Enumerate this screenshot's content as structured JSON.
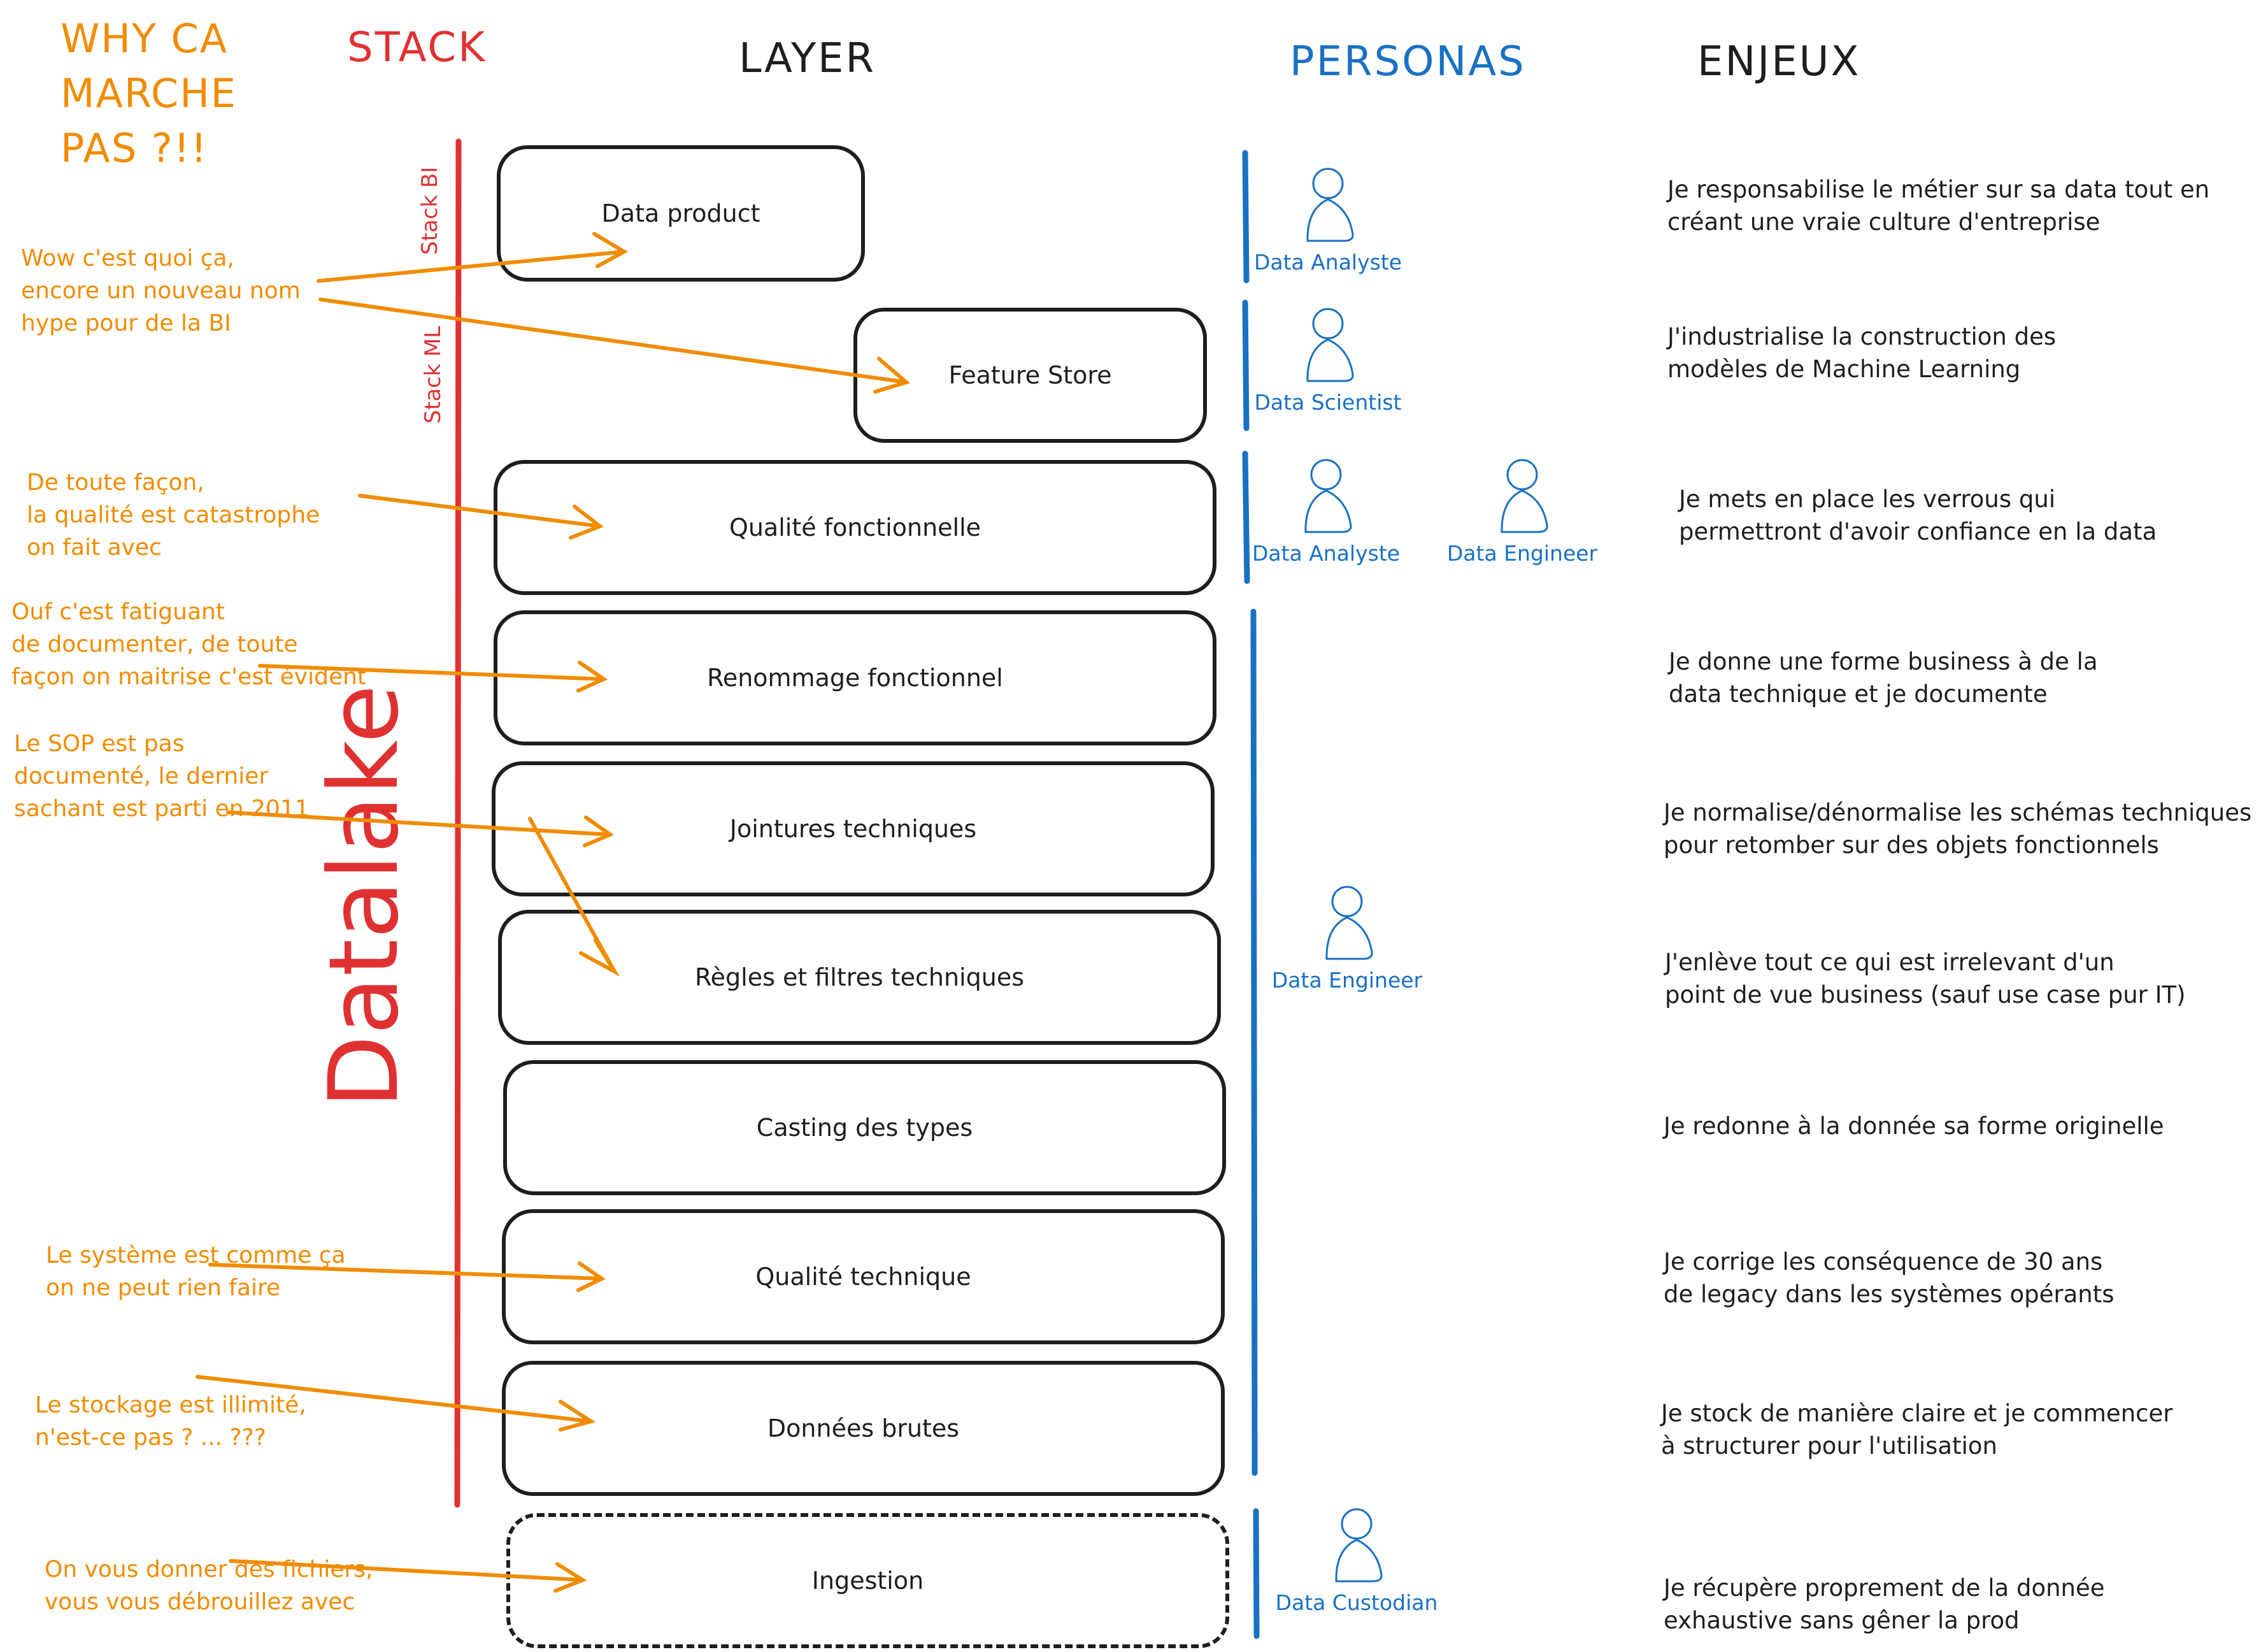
{
  "title": {
    "lines": [
      "WHY CA",
      "MARCHE",
      "PAS ?!!"
    ]
  },
  "headers": {
    "stack": "STACK",
    "layer": "LAYER",
    "personas": "PERSONAS",
    "enjeux": "ENJEUX"
  },
  "stack_labels": {
    "bi": "Stack BI",
    "ml": "Stack ML",
    "datalake": "Datalake"
  },
  "colors": {
    "orange": "#f08c00",
    "red": "#e03131",
    "blue": "#1971c2",
    "ink": "#1e1e1e"
  },
  "layers": [
    {
      "label": "Data product",
      "style": "solid"
    },
    {
      "label": "Feature Store",
      "style": "solid"
    },
    {
      "label": "Qualité fonctionnelle",
      "style": "solid"
    },
    {
      "label": "Renommage fonctionnel",
      "style": "solid"
    },
    {
      "label": "Jointures techniques",
      "style": "solid"
    },
    {
      "label": "Règles et filtres techniques",
      "style": "solid"
    },
    {
      "label": "Casting des types",
      "style": "solid"
    },
    {
      "label": "Qualité technique",
      "style": "solid"
    },
    {
      "label": "Données brutes",
      "style": "solid"
    },
    {
      "label": "Ingestion",
      "style": "dashed"
    }
  ],
  "comments": [
    {
      "text": "Wow c'est quoi ça,\nencore un nouveau nom\nhype pour de la BI",
      "targets": [
        "Data product",
        "Feature Store"
      ]
    },
    {
      "text": "De toute façon,\nla qualité est catastrophe\non fait avec",
      "targets": [
        "Qualité fonctionnelle"
      ]
    },
    {
      "text": "Ouf c'est fatiguant\nde documenter, de toute\nfaçon on maitrise c'est évident",
      "targets": [
        "Renommage fonctionnel"
      ]
    },
    {
      "text": "Le SOP est pas\ndocumenté, le dernier\nsachant est parti en 2011",
      "targets": [
        "Jointures techniques",
        "Règles et filtres techniques"
      ]
    },
    {
      "text": "Le système est comme ça\non ne peut rien faire",
      "targets": [
        "Qualité technique"
      ]
    },
    {
      "text": "Le stockage est illimité,\nn'est-ce pas ? ... ???",
      "targets": [
        "Données brutes"
      ]
    },
    {
      "text": "On vous donner des fichiers,\nvous vous débrouillez avec",
      "targets": [
        "Ingestion"
      ]
    }
  ],
  "personas": [
    {
      "label": "Data Analyste",
      "group": "data-product"
    },
    {
      "label": "Data Scientist",
      "group": "feature-store"
    },
    {
      "label": "Data Analyste",
      "group": "qualite-fonctionnelle"
    },
    {
      "label": "Data Engineer",
      "group": "qualite-fonctionnelle"
    },
    {
      "label": "Data Engineer",
      "group": "technique"
    },
    {
      "label": "Data Custodian",
      "group": "ingestion"
    }
  ],
  "enjeux": [
    "Je responsabilise le métier sur sa data tout en\ncréant une vraie culture d'entreprise",
    "J'industrialise la construction des\nmodèles de Machine Learning",
    "Je mets en place les verrous qui\npermettront d'avoir confiance en la data",
    "Je donne une forme business à de la\ndata technique et je documente",
    "Je normalise/dénormalise les schémas techniques\npour retomber sur des objets fonctionnels",
    "J'enlève tout ce qui est irrelevant d'un\npoint de vue business (sauf use case pur IT)",
    "Je redonne à la donnée sa forme originelle",
    "Je corrige les conséquence de 30 ans\nde legacy dans les systèmes opérants",
    "Je stock de manière claire et je commencer\nà structurer pour l'utilisation",
    "Je récupère proprement de la donnée\nexhaustive sans gêner la prod"
  ]
}
